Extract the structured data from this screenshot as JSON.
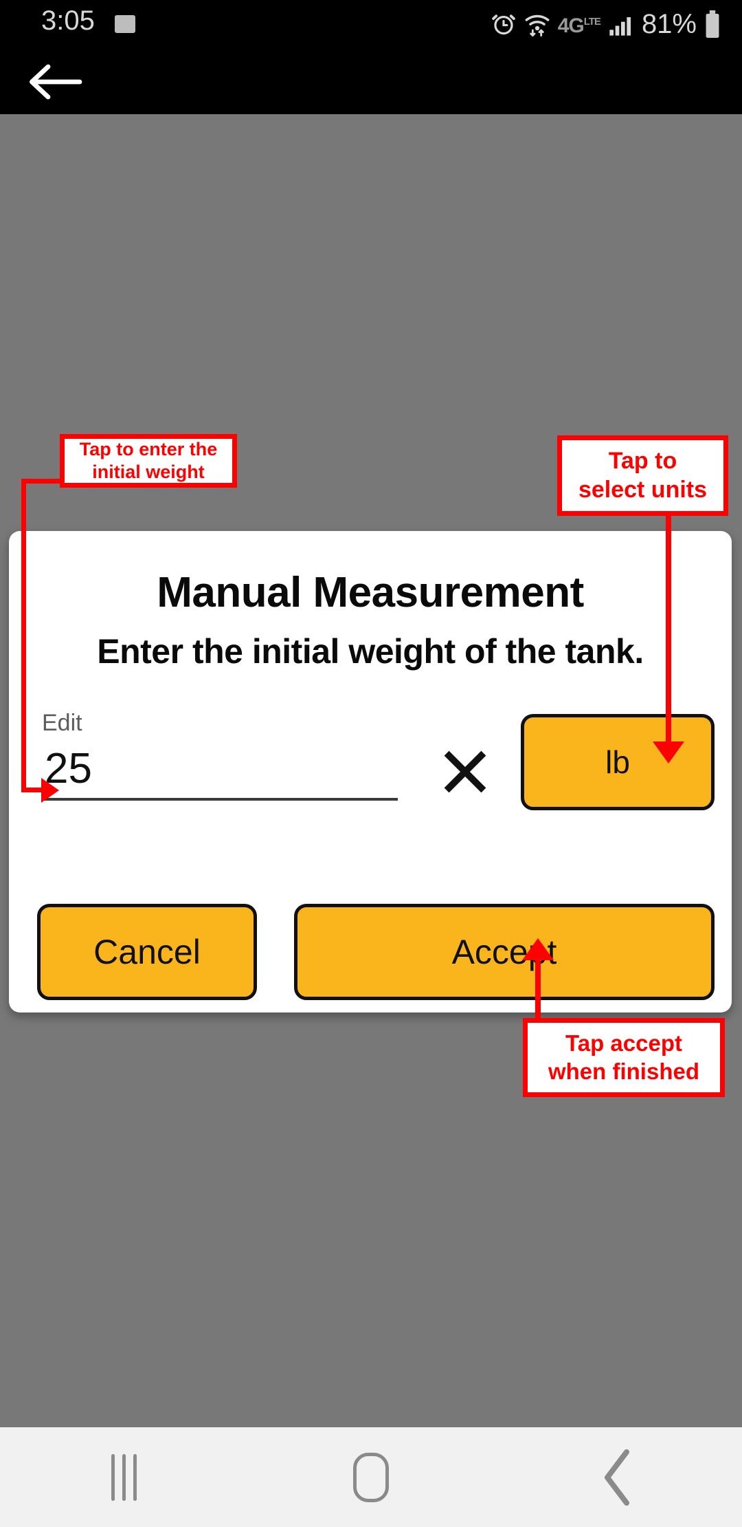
{
  "status_bar": {
    "time": "3:05",
    "battery_percent": "81%",
    "network": "4G LTE",
    "icons": [
      "gallery-icon",
      "alarm-icon",
      "wifi-icon",
      "lte-icon",
      "signal-icon",
      "battery-icon"
    ]
  },
  "app_bar": {
    "back_icon": "back-arrow-icon"
  },
  "dialog": {
    "title": "Manual Measurement",
    "subtitle": "Enter the initial weight of the tank.",
    "input_label": "Edit",
    "input_value": "25",
    "input_placeholder": "",
    "clear_icon": "close-x-icon",
    "unit_value": "lb",
    "cancel_label": "Cancel",
    "accept_label": "Accept"
  },
  "annotations": [
    {
      "id": "enter-weight",
      "line1": "Tap to enter the",
      "line2": "initial weight"
    },
    {
      "id": "select-units",
      "line1": "Tap to",
      "line2": "select units"
    },
    {
      "id": "tap-accept",
      "line1": "Tap accept",
      "line2": "when finished"
    }
  ],
  "nav_bar": {
    "recents_icon": "recents-icon",
    "home_icon": "home-icon",
    "back_icon": "back-chevron-icon"
  },
  "colors": {
    "accent": "#FAB51C",
    "annotation": "#FF0000",
    "scrim": "#787878",
    "nav_bar": "#F1F1F1"
  }
}
